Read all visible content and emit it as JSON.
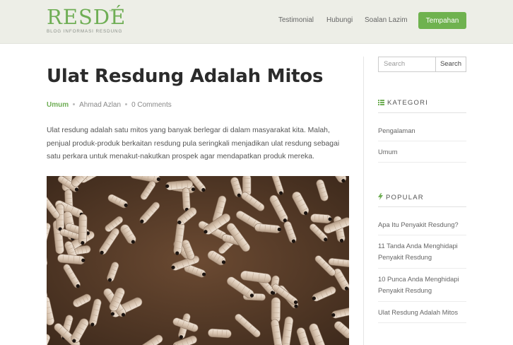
{
  "brand": {
    "logo_text": "RESDÉ",
    "logo_tm": "™",
    "tagline": "BLOG INFORMASI RESDUNG",
    "accent_color": "#6fae55"
  },
  "nav": {
    "items": [
      "Testimonial",
      "Hubungi",
      "Soalan Lazim"
    ],
    "cta_label": "Tempahan"
  },
  "post": {
    "title": "Ulat Resdung Adalah Mitos",
    "category": "Umum",
    "author": "Ahmad Azlan",
    "comments": "0 Comments",
    "excerpt": "Ulat resdung adalah satu mitos yang banyak berlegar di dalam masyarakat kita. Malah, penjual produk-produk berkaitan resdung pula seringkali menjadikan ulat resdung sebagai satu perkara untuk menakut-nakutkan prospek agar mendapatkan produk mereka.",
    "image_icon": "larvae-photo"
  },
  "sidebar": {
    "search_placeholder": "Search",
    "search_button": "Search",
    "kategori_title": "KATEGORI",
    "kategori_items": [
      "Pengalaman",
      "Umum"
    ],
    "popular_title": "POPULAR",
    "popular_items": [
      "Apa Itu Penyakit Resdung?",
      "11 Tanda Anda Menghidapi Penyakit Resdung",
      "10 Punca Anda Menghidapi Penyakit Resdung",
      "Ulat Resdung Adalah Mitos"
    ]
  }
}
